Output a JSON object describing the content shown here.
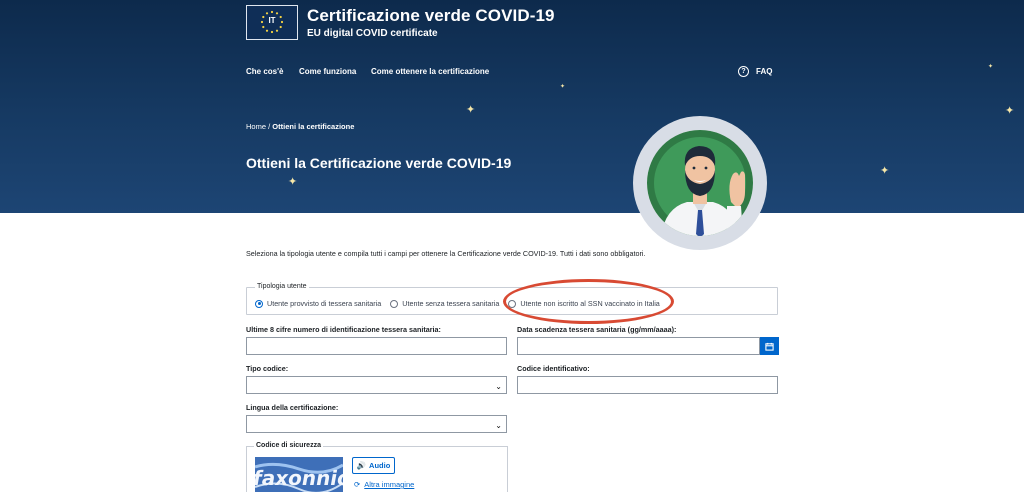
{
  "header": {
    "logo_code": "IT",
    "title": "Certificazione verde COVID-19",
    "subtitle": "EU digital COVID certificate",
    "nav": [
      "Che cos'è",
      "Come funziona",
      "Come ottenere la certificazione"
    ],
    "faq_label": "FAQ",
    "faq_icon": "question-circle-icon"
  },
  "breadcrumb": {
    "home": "Home",
    "separator": " / ",
    "current": "Ottieni la certificazione"
  },
  "page_title": "Ottieni la Certificazione verde COVID-19",
  "intro": "Seleziona la tipologia utente e compila tutti i campi per ottenere la Certificazione verde COVID-19. Tutti i dati sono obbligatori.",
  "user_type": {
    "legend": "Tipologia utente",
    "options": [
      {
        "label": "Utente provvisto di tessera sanitaria",
        "selected": true
      },
      {
        "label": "Utente senza tessera sanitaria",
        "selected": false
      },
      {
        "label": "Utente non iscritto al SSN vaccinato in Italia",
        "selected": false
      }
    ]
  },
  "form": {
    "card_digits_label": "Ultime 8 cifre numero di identificazione tessera sanitaria:",
    "card_expiry_label": "Data scadenza tessera sanitaria (gg/mm/aaaa):",
    "code_type_label": "Tipo codice:",
    "code_id_label": "Codice identificativo:",
    "language_label": "Lingua della certificazione:"
  },
  "security": {
    "legend": "Codice di sicurezza",
    "captcha_text": "faxonnio",
    "audio_label": "Audio",
    "reload_label": "Altra immagine"
  },
  "colors": {
    "accent": "#0066cc",
    "hero": "#163a63",
    "highlight": "#d84a33"
  }
}
